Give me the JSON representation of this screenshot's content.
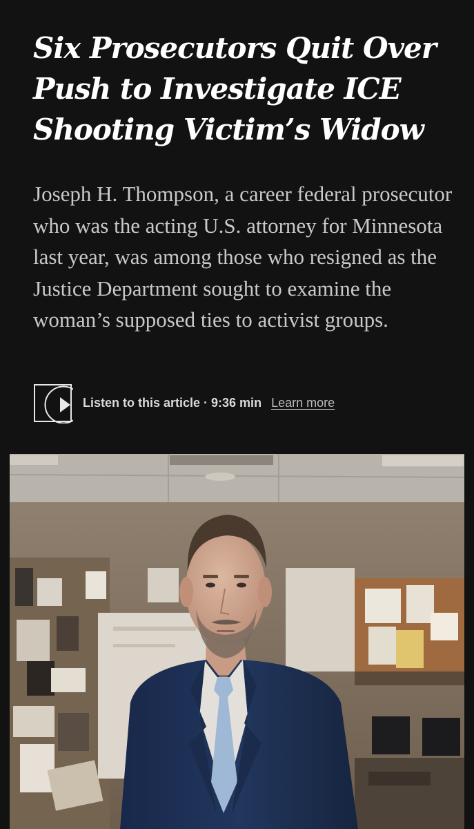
{
  "article": {
    "headline": "Six Prosecutors Quit Over Push to Investigate ICE Shooting Victim’s Widow",
    "summary": "Joseph H. Thompson, a career federal prosecutor who was the acting U.S. attorney for Minnesota last year, was among those who resigned as the Justice Department sought to examine the woman’s supposed ties to activist groups."
  },
  "audio": {
    "listen_label": "Listen to this article · 9:36 min",
    "learn_more": "Learn more",
    "icon": "play-icon"
  },
  "photo": {
    "subject": "man in navy suit and light blue tie standing in an office"
  },
  "colors": {
    "background": "#121212",
    "headline": "#ffffff",
    "summary": "#c9c9c9",
    "suit": "#1f3256",
    "tie": "#9fb8d6"
  }
}
